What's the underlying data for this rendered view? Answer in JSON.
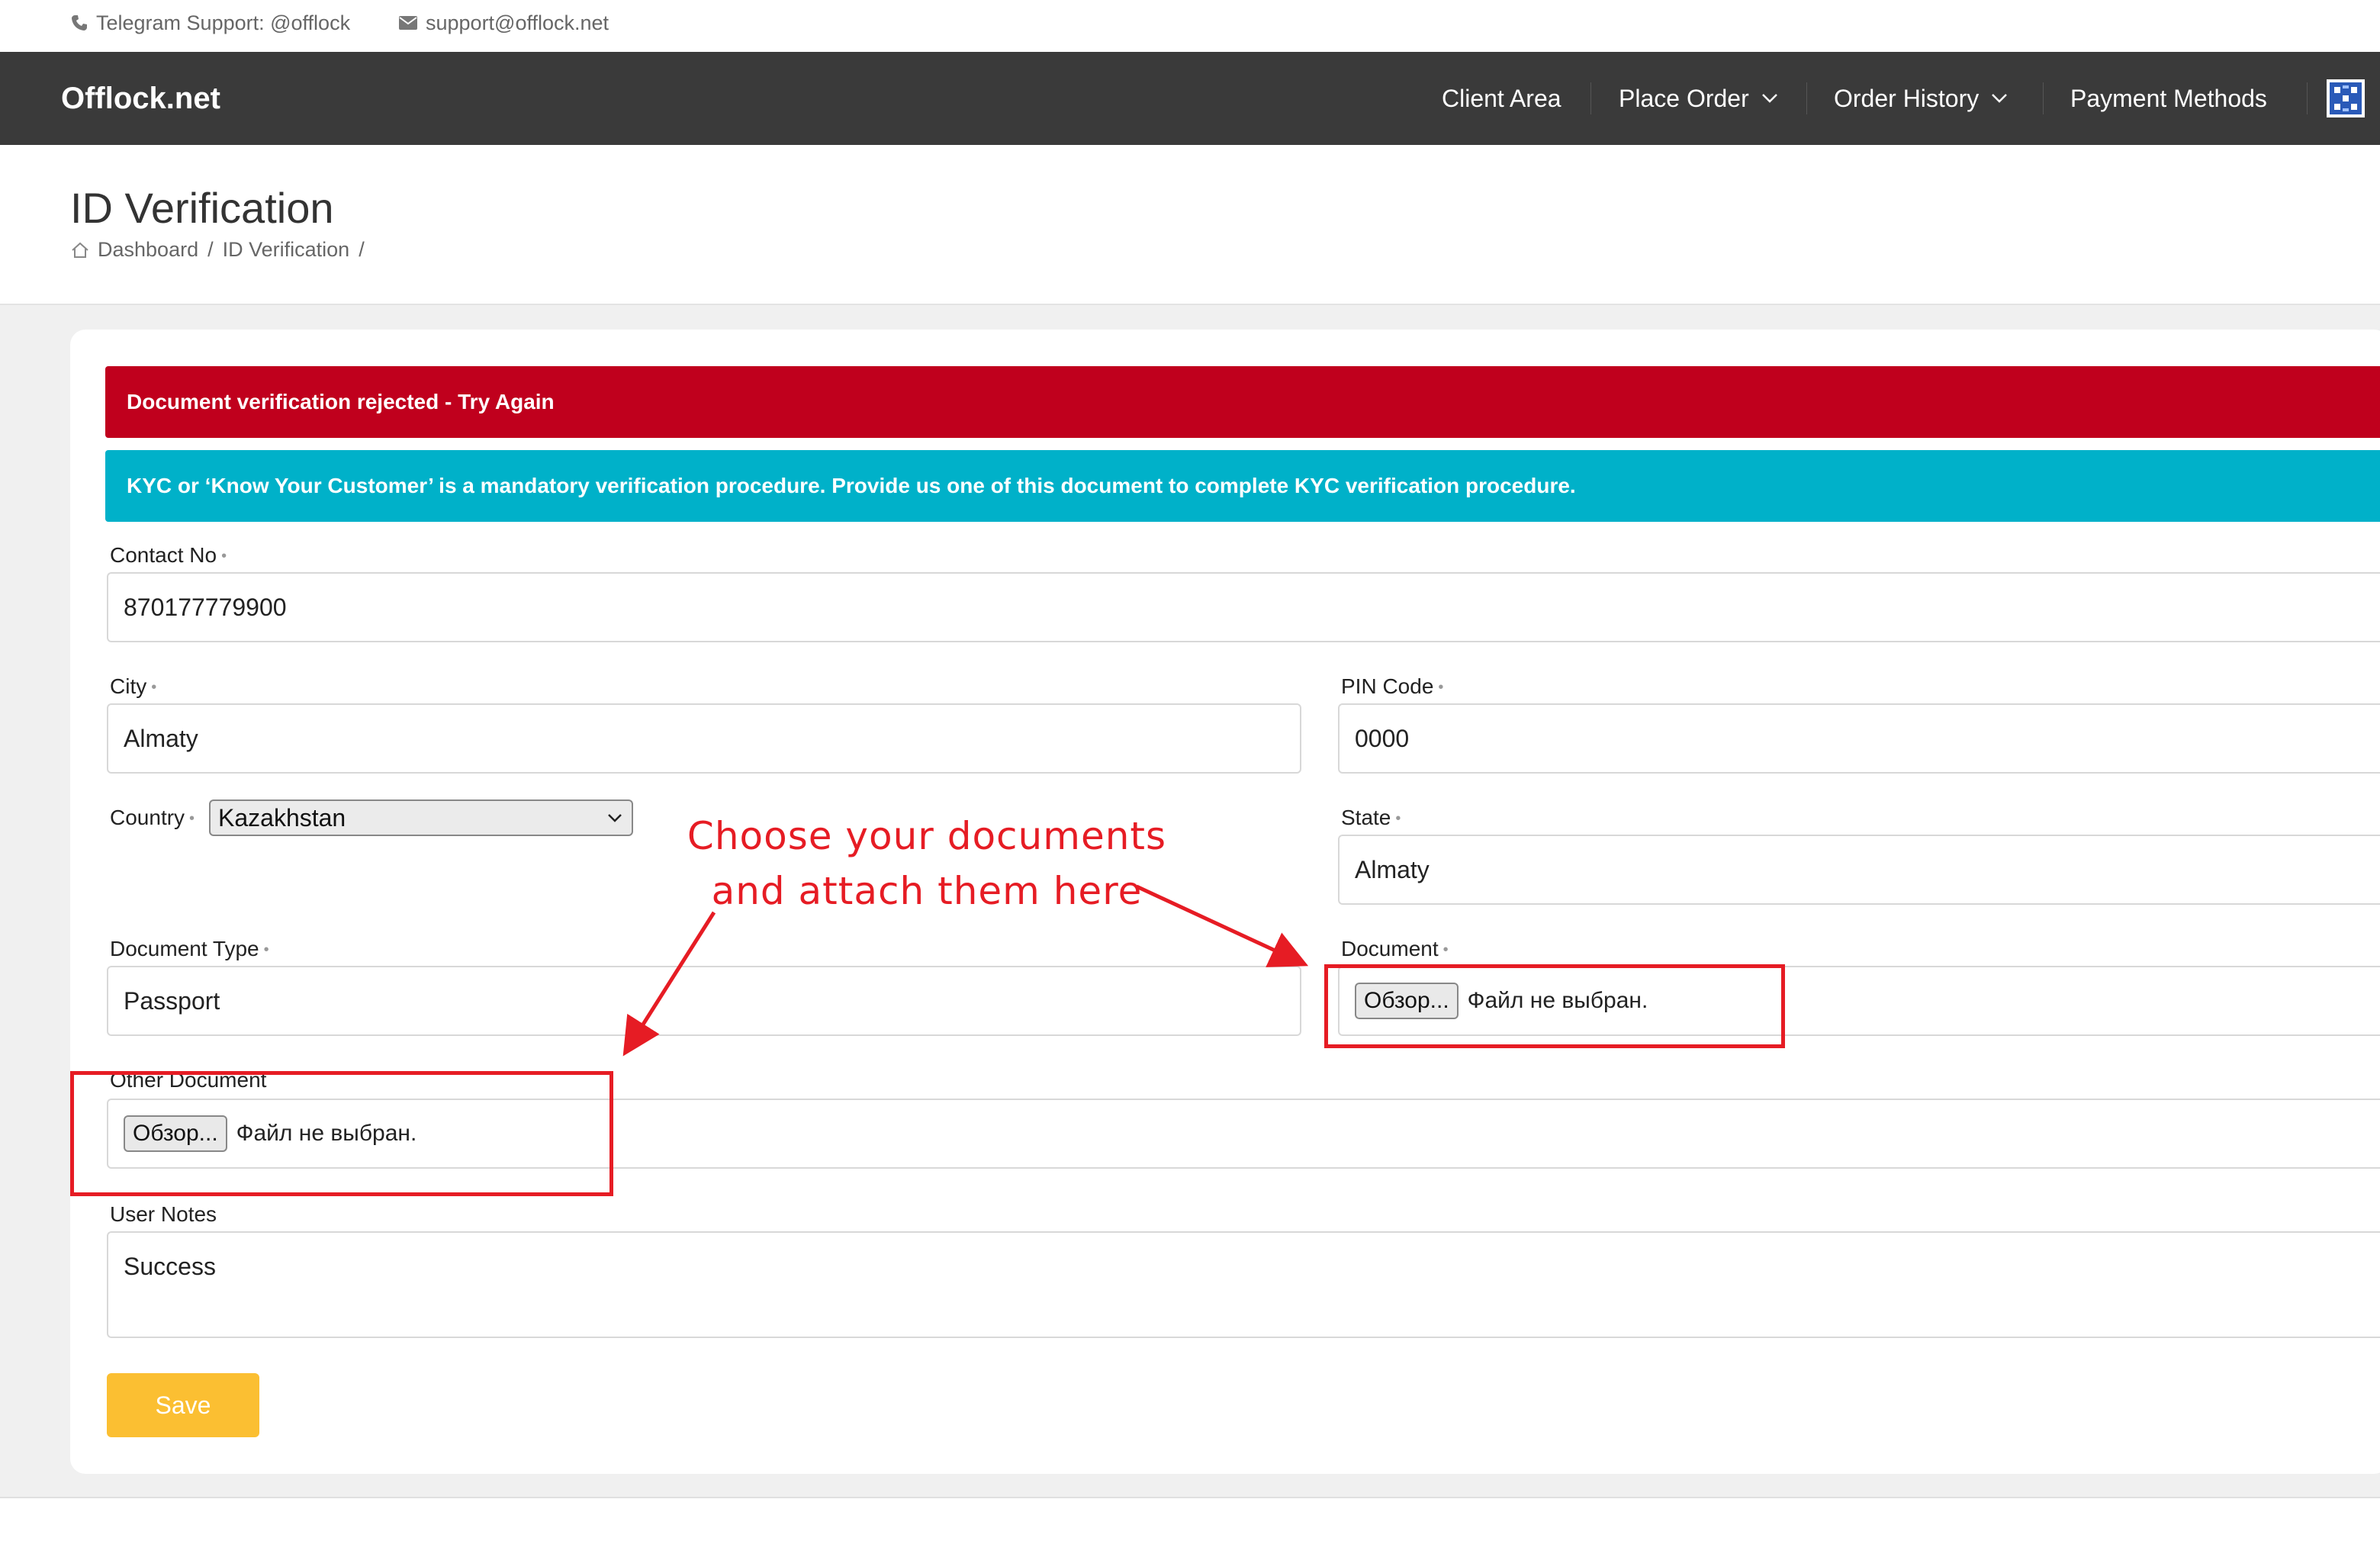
{
  "topbar": {
    "telegram": "Telegram Support: @offlock",
    "email": "support@offlock.net"
  },
  "navbar": {
    "brand": "Offlock.net",
    "items": [
      {
        "label": "Client Area"
      },
      {
        "label": "Place Order"
      },
      {
        "label": "Order History"
      },
      {
        "label": "Payment Methods"
      }
    ]
  },
  "page": {
    "title": "ID Verification",
    "breadcrumb": [
      "Dashboard",
      "/",
      "ID Verification",
      "/"
    ]
  },
  "alerts": {
    "danger": "Document verification rejected - Try Again",
    "info": "KYC or ‘Know Your Customer’ is a mandatory verification procedure. Provide us one of this document to complete KYC verification procedure."
  },
  "form": {
    "contact_label": "Contact No",
    "contact_value": "870177779900",
    "city_label": "City",
    "city_value": "Almaty",
    "pin_label": "PIN Code",
    "pin_value": "0000",
    "country_label": "Country",
    "country_value": "Kazakhstan",
    "state_label": "State",
    "state_value": "Almaty",
    "doctype_label": "Document Type",
    "doctype_value": "Passport",
    "document_label": "Document",
    "other_document_label": "Other Document",
    "browse_label": "Обзор...",
    "no_file_text": "Файл не выбран.",
    "notes_label": "User Notes",
    "notes_value": "Success",
    "required_mark": "•",
    "save_label": "Save"
  },
  "annotation": {
    "line1": "Choose your documents",
    "line2": "and attach them here",
    "color": "#e61c24"
  },
  "colors": {
    "navbar": "#3a3a3a",
    "danger": "#c0001d",
    "info": "#00b1c9",
    "save": "#fbbf32"
  }
}
